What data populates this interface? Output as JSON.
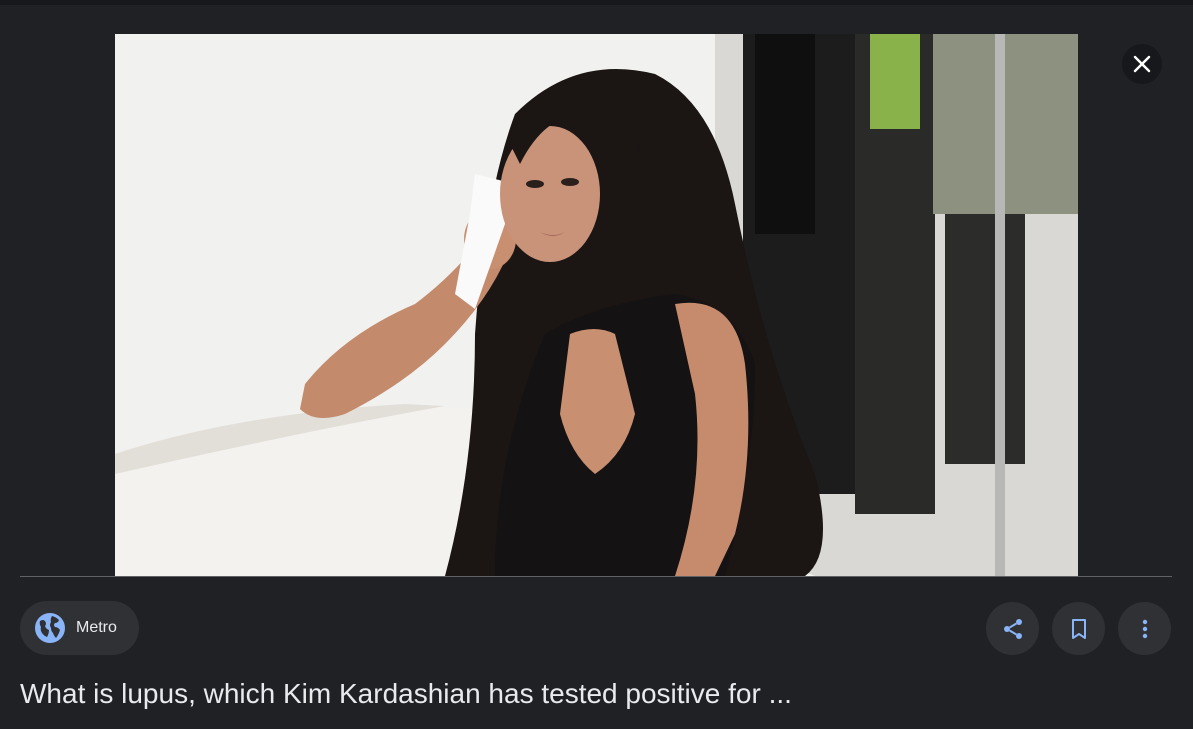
{
  "viewer": {
    "close_label": "Close",
    "image_alt": "Kim Kardashian wiping her eye with a tissue"
  },
  "source": {
    "name": "Metro",
    "icon": "globe-icon"
  },
  "actions": [
    {
      "name": "share",
      "icon": "share-icon"
    },
    {
      "name": "save",
      "icon": "bookmark-icon"
    },
    {
      "name": "more",
      "icon": "more-vert-icon"
    }
  ],
  "result": {
    "title": "What is lupus, which Kim Kardashian has tested positive for ..."
  },
  "colors": {
    "background": "#202124",
    "chip": "#303134",
    "accent": "#8ab4f8",
    "text": "#e8eaed"
  }
}
